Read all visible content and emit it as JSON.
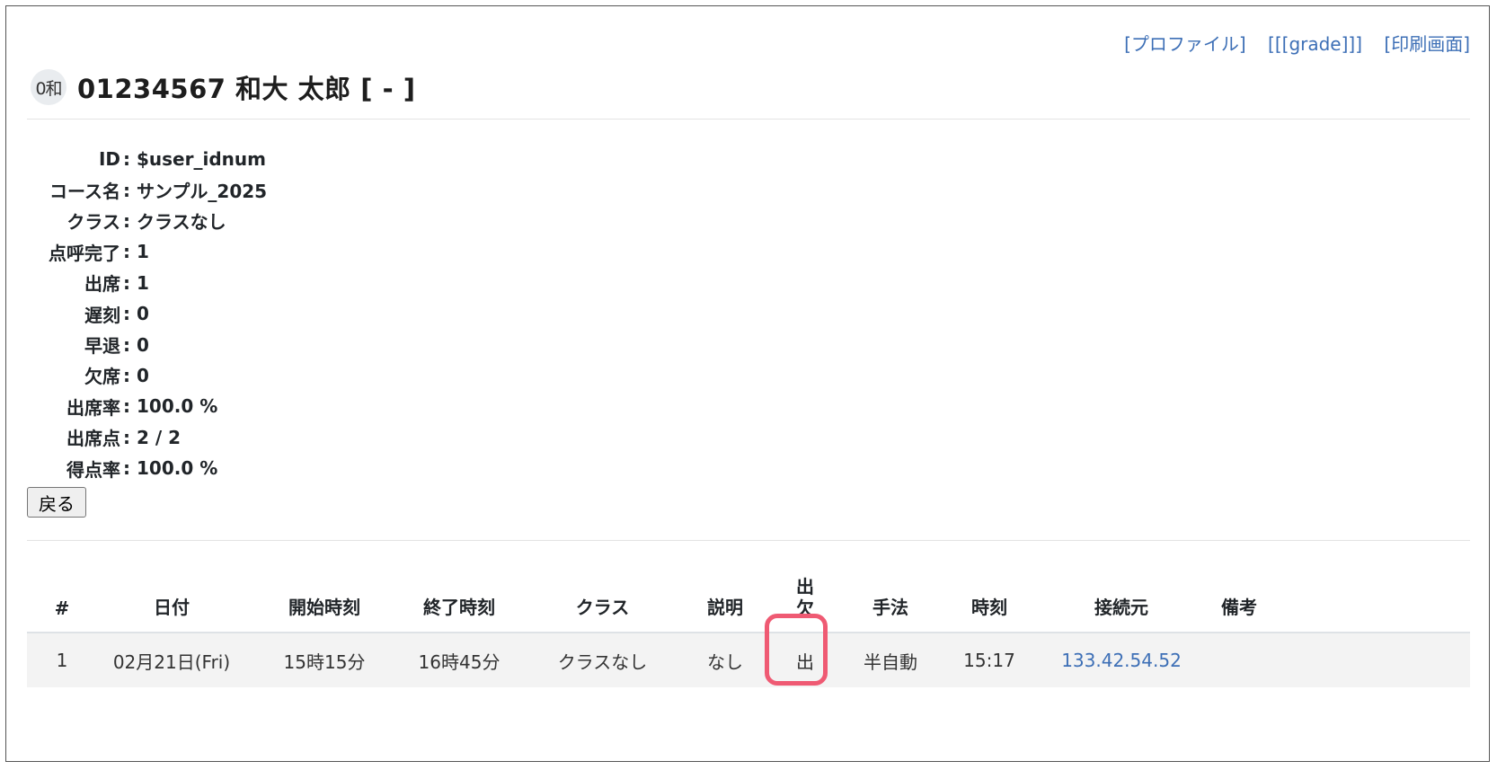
{
  "links": {
    "profile": "[プロファイル]",
    "grade": "[[[grade]]]",
    "print": "[印刷画面]"
  },
  "header": {
    "avatar_text": "0和",
    "title": "01234567 和大 太郎 [ - ]"
  },
  "info": [
    {
      "label": "ID",
      "value": "$user_idnum"
    },
    {
      "label": "コース名",
      "value": "サンプル_2025"
    },
    {
      "label": "クラス",
      "value": "クラスなし"
    },
    {
      "label": "点呼完了",
      "value": "1"
    },
    {
      "label": "出席",
      "value": "1"
    },
    {
      "label": "遅刻",
      "value": "0"
    },
    {
      "label": "早退",
      "value": "0"
    },
    {
      "label": "欠席",
      "value": "0"
    },
    {
      "label": "出席率",
      "value": "100.0 %"
    },
    {
      "label": "出席点",
      "value": "2 / 2"
    },
    {
      "label": "得点率",
      "value": "100.0 %"
    }
  ],
  "colon": ":",
  "back_button": "戻る",
  "table": {
    "headers": [
      "#",
      "日付",
      "開始時刻",
      "終了時刻",
      "クラス",
      "説明",
      "出欠",
      "手法",
      "時刻",
      "接続元",
      "備考"
    ],
    "header_attendance_line1": "出",
    "header_attendance_line2": "欠",
    "rows": [
      {
        "num": "1",
        "date": "02月21日(Fri)",
        "start": "15時15分",
        "end": "16時45分",
        "class": "クラスなし",
        "desc": "なし",
        "status": "出",
        "method": "半自動",
        "time": "15:17",
        "ip": "133.42.54.52",
        "note": ""
      }
    ]
  },
  "colors": {
    "link": "#3d6fb6",
    "highlight": "#ef5a73"
  }
}
